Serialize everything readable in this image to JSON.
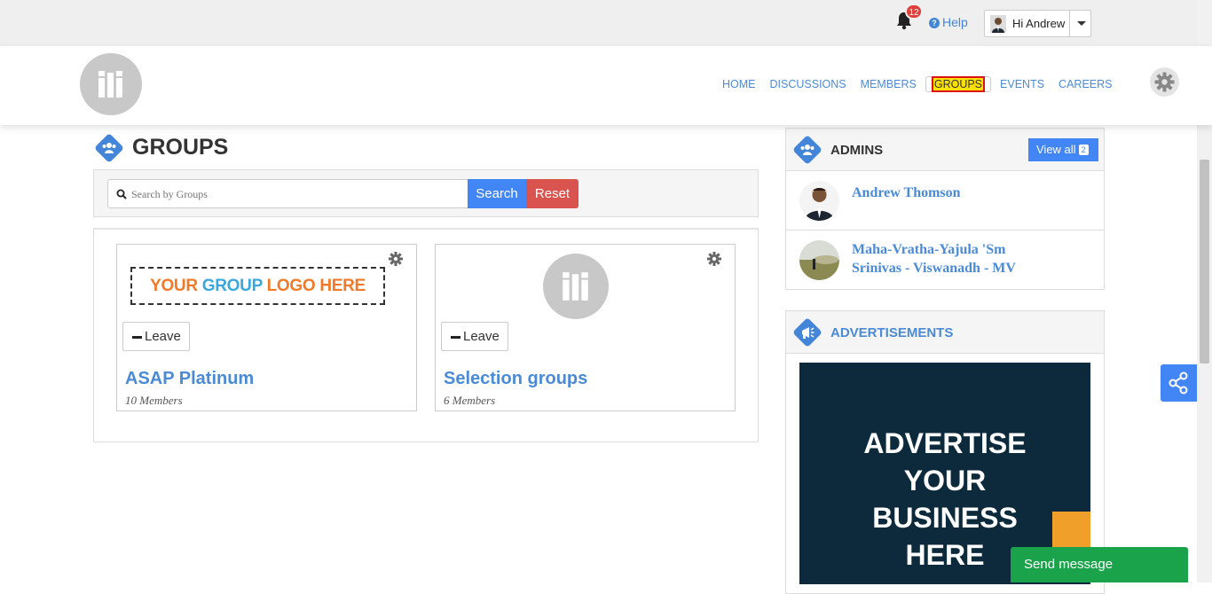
{
  "topbar": {
    "notification_count": "12",
    "help_label": "Help",
    "user_greeting": "Hi Andrew"
  },
  "nav": {
    "items": [
      {
        "label": "HOME",
        "active": false
      },
      {
        "label": "DISCUSSIONS",
        "active": false
      },
      {
        "label": "MEMBERS",
        "active": false
      },
      {
        "label": "GROUPS",
        "active": true
      },
      {
        "label": "EVENTS",
        "active": false
      },
      {
        "label": "CAREERS",
        "active": false
      }
    ]
  },
  "page": {
    "title": "GROUPS",
    "search_placeholder": "Search by Groups",
    "search_label": "Search",
    "reset_label": "Reset"
  },
  "groups": [
    {
      "name": "ASAP Platinum",
      "members": "10 Members",
      "action": "Leave",
      "logo_text": [
        "YOUR",
        "GROUP",
        "LOGO HERE"
      ]
    },
    {
      "name": "Selection groups",
      "members": "6 Members",
      "action": "Leave"
    }
  ],
  "admins": {
    "title": "ADMINS",
    "view_all_label": "View all",
    "view_all_count": "2",
    "list": [
      {
        "name_line1": "Andrew Thomson",
        "name_line2": ""
      },
      {
        "name_line1": "Maha-Vratha-Yajula 'Sm",
        "name_line2": "Srinivas - Viswanadh - MV"
      }
    ]
  },
  "ads": {
    "title": "ADVERTISEMENTS",
    "banner_lines": [
      "ADVERTISE",
      "YOUR",
      "BUSINESS",
      "HERE"
    ]
  },
  "chat": {
    "send_label": "Send message"
  },
  "colors": {
    "accent": "#4285f4",
    "link": "#4a8ad6",
    "danger": "#d9534f",
    "success": "#1aa34a",
    "badge": "#e0403b"
  }
}
